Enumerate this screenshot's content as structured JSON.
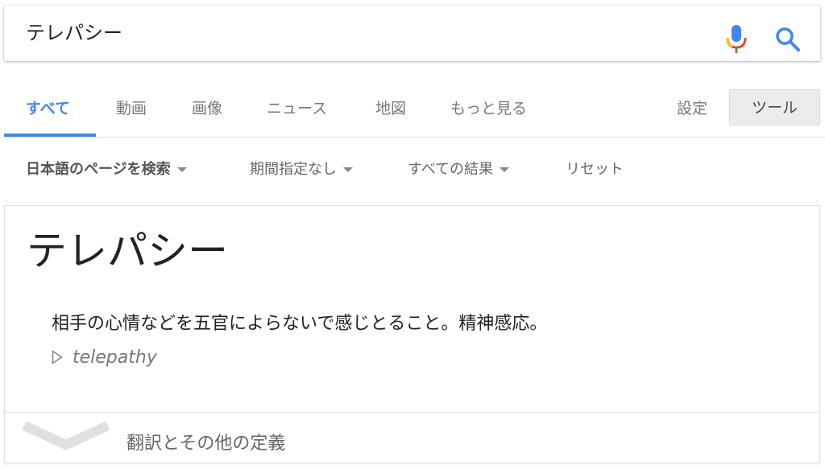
{
  "search": {
    "query": "テレパシー",
    "mic_icon": "microphone-icon",
    "search_icon": "search-icon",
    "colors": {
      "blue": "#4285f4",
      "red": "#ea4335",
      "yellow": "#fbbc05",
      "green": "#34a853"
    }
  },
  "tabs": {
    "items": [
      {
        "label": "すべて",
        "active": true
      },
      {
        "label": "動画"
      },
      {
        "label": "画像"
      },
      {
        "label": "ニュース"
      },
      {
        "label": "地図"
      },
      {
        "label": "もっと見る"
      }
    ],
    "settings": "設定",
    "tools": "ツール"
  },
  "filters": {
    "language": "日本語のページを検索",
    "period": "期間指定なし",
    "results": "すべての結果",
    "reset": "リセット"
  },
  "card": {
    "term": "テレパシー",
    "definition": "相手の心情などを五官によらないで感じとること。精神感応。",
    "translation": "telepathy",
    "more": "翻訳とその他の定義"
  }
}
